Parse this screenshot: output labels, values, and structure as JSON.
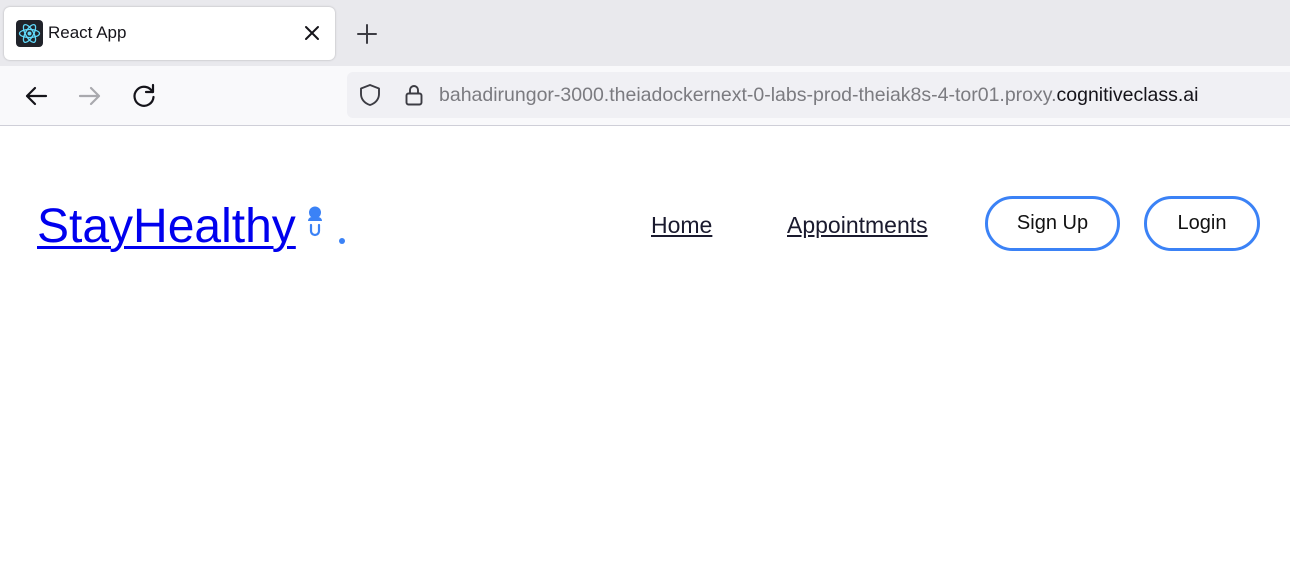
{
  "browser": {
    "tab": {
      "title": "React App",
      "favicon": "react-logo-icon",
      "close_icon": "close-icon"
    },
    "new_tab_icon": "plus-icon",
    "nav": {
      "back_icon": "arrow-left-icon",
      "forward_icon": "arrow-right-icon",
      "reload_icon": "reload-icon"
    },
    "url": {
      "shield_icon": "shield-icon",
      "lock_icon": "lock-icon",
      "prefix": "bahadirungor-3000.theiadockernext-0-labs-prod-theiak8s-4-tor01.proxy.",
      "domain": "cognitiveclass.ai"
    }
  },
  "page": {
    "brand": {
      "label": "StayHealthy",
      "icon": "doctor-stethoscope-icon"
    },
    "nav_links": [
      "Home",
      "Appointments"
    ],
    "buttons": {
      "signup": "Sign Up",
      "login": "Login"
    },
    "colors": {
      "accent": "#3b82f6",
      "link": "#0000ee",
      "text": "#1a1a2e"
    }
  }
}
